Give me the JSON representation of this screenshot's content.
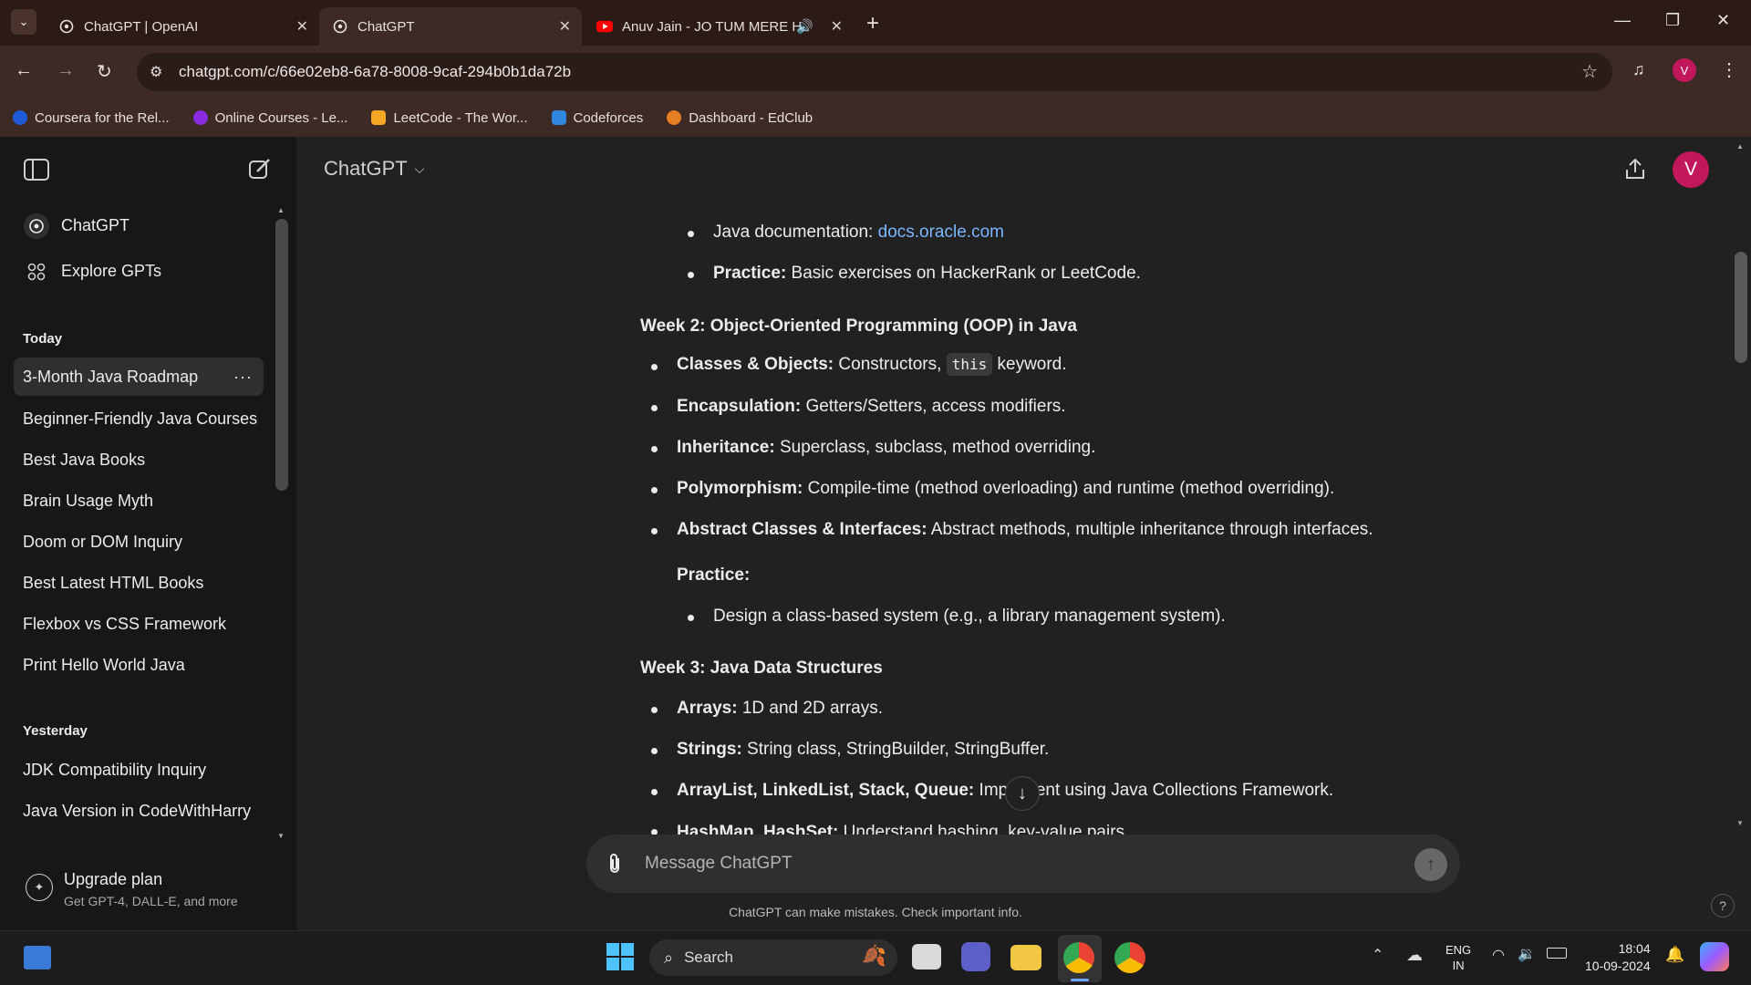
{
  "browser": {
    "tabs": [
      {
        "title": "ChatGPT | OpenAI"
      },
      {
        "title": "ChatGPT"
      },
      {
        "title": "Anuv Jain - JO TUM MERE H"
      }
    ],
    "url": "chatgpt.com/c/66e02eb8-6a78-8008-9caf-294b0b1da72b",
    "profile_initial": "V",
    "bookmarks": [
      {
        "label": "Coursera for the Rel...",
        "color": "#1f5bd8"
      },
      {
        "label": "Online Courses - Le...",
        "color": "#8a2be2"
      },
      {
        "label": "LeetCode - The Wor...",
        "color": "#f5a623"
      },
      {
        "label": "Codeforces",
        "color": "#2e86de"
      },
      {
        "label": "Dashboard - EdClub",
        "color": "#e67e22"
      }
    ]
  },
  "sidebar": {
    "top_items": [
      {
        "label": "ChatGPT",
        "icon": "chatgpt-logo-icon"
      },
      {
        "label": "Explore GPTs",
        "icon": "grid-icon"
      }
    ],
    "today_label": "Today",
    "today": [
      "3-Month Java Roadmap",
      "Beginner-Friendly Java Courses",
      "Best Java Books",
      "Brain Usage Myth",
      "Doom or DOM Inquiry",
      "Best Latest HTML Books",
      "Flexbox vs CSS Framework",
      "Print Hello World Java"
    ],
    "yesterday_label": "Yesterday",
    "yesterday": [
      "JDK Compatibility Inquiry",
      "Java Version in CodeWithHarry"
    ],
    "upgrade": {
      "title": "Upgrade plan",
      "subtitle": "Get GPT-4, DALL-E, and more"
    }
  },
  "header": {
    "model": "ChatGPT",
    "avatar": "V"
  },
  "content": {
    "week1_docs_label": "Java documentation: ",
    "week1_docs_link": "docs.oracle.com",
    "week1_practice_bold": "Practice:",
    "week1_practice_text": " Basic exercises on HackerRank or LeetCode.",
    "week2_title": "Week 2: Object-Oriented Programming (OOP) in Java",
    "week2_items": [
      {
        "bold": "Classes & Objects:",
        "text": " Constructors, ",
        "code": "this",
        "text2": " keyword."
      },
      {
        "bold": "Encapsulation:",
        "text": " Getters/Setters, access modifiers."
      },
      {
        "bold": "Inheritance:",
        "text": " Superclass, subclass, method overriding."
      },
      {
        "bold": "Polymorphism:",
        "text": " Compile-time (method overloading) and runtime (method overriding)."
      },
      {
        "bold": "Abstract Classes & Interfaces:",
        "text": " Abstract methods, multiple inheritance through interfaces."
      }
    ],
    "week2_practice_label": "Practice:",
    "week2_practice_item": "Design a class-based system (e.g., a library management system).",
    "week3_title": "Week 3: Java Data Structures",
    "week3_items": [
      {
        "bold": "Arrays:",
        "text": " 1D and 2D arrays."
      },
      {
        "bold": "Strings:",
        "text": " String class, StringBuilder, StringBuffer."
      },
      {
        "bold": "ArrayList, LinkedList, Stack, Queue:",
        "text": " Implement using Java Collections Framework."
      },
      {
        "bold": "HashMap, HashSet:",
        "text": " Understand hashing, key-value pairs."
      }
    ]
  },
  "composer": {
    "placeholder": "Message ChatGPT"
  },
  "footer_note": "ChatGPT can make mistakes. Check important info.",
  "taskbar": {
    "search_label": "Search",
    "lang_line1": "ENG",
    "lang_line2": "IN",
    "time": "18:04",
    "date": "10-09-2024"
  },
  "colors": {
    "accent": "#10a37f",
    "avatar_bg": "#c2185b",
    "link": "#7ab7ff"
  }
}
